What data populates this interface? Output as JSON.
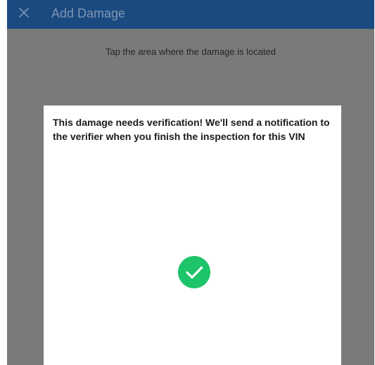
{
  "app_bar": {
    "title": "Add Damage",
    "close_icon": "close-icon",
    "background_color": "#1a4a80"
  },
  "main": {
    "instruction": "Tap the area where the damage is located"
  },
  "dialog": {
    "message": "This damage needs verification! We'll send a notification to the verifier when you finish the inspection for this VIN",
    "status_icon": "check-circle-icon",
    "status_color": "#1ec46a"
  }
}
